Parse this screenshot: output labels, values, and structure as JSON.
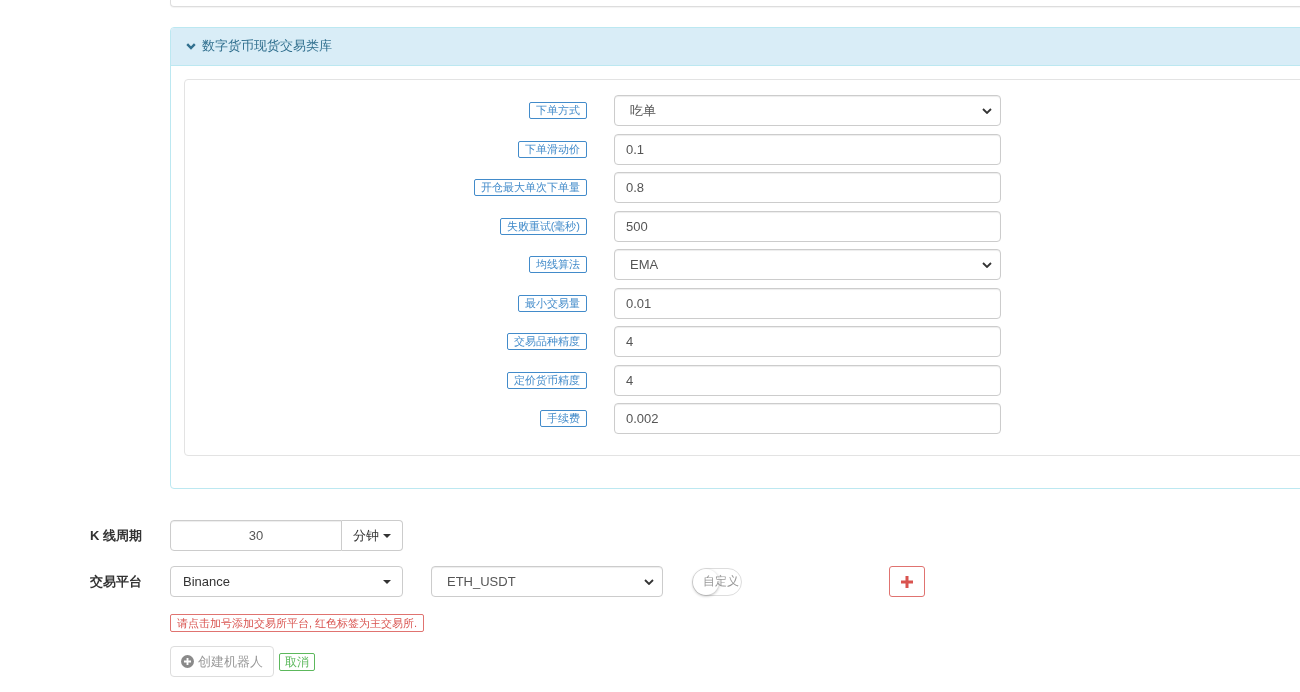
{
  "panel": {
    "title": "数字货币现货交易类库",
    "expanded": true,
    "fields": [
      {
        "label": "下单方式",
        "kind": "select",
        "value": "吃单"
      },
      {
        "label": "下单滑动价",
        "kind": "input",
        "value": "0.1"
      },
      {
        "label": "开仓最大单次下单量",
        "kind": "input",
        "value": "0.8"
      },
      {
        "label": "失败重试(毫秒)",
        "kind": "input",
        "value": "500"
      },
      {
        "label": "均线算法",
        "kind": "select",
        "value": "EMA"
      },
      {
        "label": "最小交易量",
        "kind": "input",
        "value": "0.01"
      },
      {
        "label": "交易品种精度",
        "kind": "input",
        "value": "4"
      },
      {
        "label": "定价货币精度",
        "kind": "input",
        "value": "4"
      },
      {
        "label": "手续费",
        "kind": "input",
        "value": "0.002"
      }
    ]
  },
  "kline_period": {
    "label": "K 线周期",
    "value": "30",
    "unit": "分钟"
  },
  "exchange": {
    "label": "交易平台",
    "platform": "Binance",
    "pair": "ETH_USDT",
    "custom": {
      "label": "自定义",
      "on": false
    }
  },
  "hint": "请点击加号添加交易所平台, 红色标签为主交易所.",
  "actions": [
    {
      "kind": "button",
      "label": "创建机器人"
    },
    {
      "kind": "tag",
      "label": "取消"
    }
  ]
}
